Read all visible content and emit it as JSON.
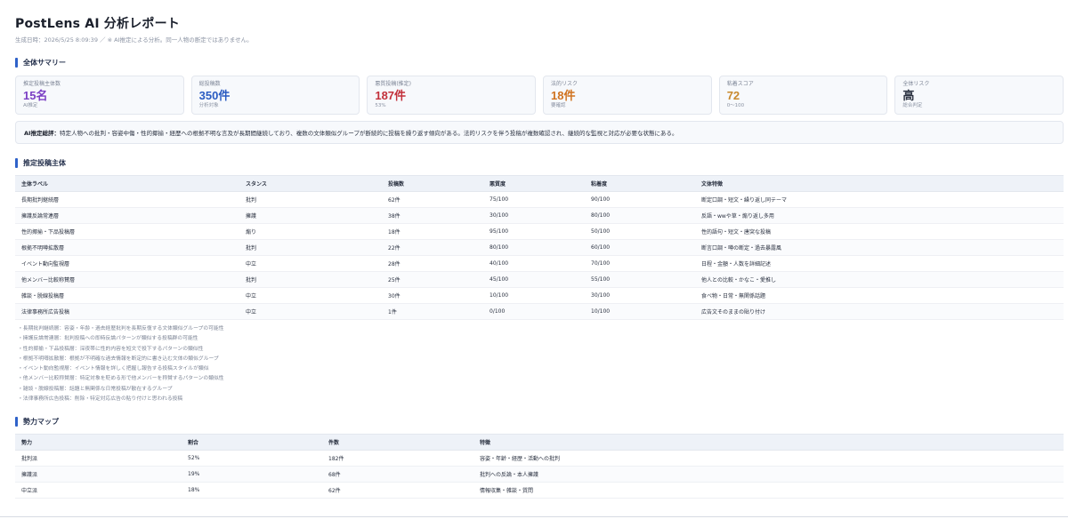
{
  "header": {
    "title": "PostLens AI 分析レポート",
    "meta": "生成日時：2026/5/25 8:09:39 ／ ※ AI推定による分析。同一人物の断定ではありません。"
  },
  "summary_section": {
    "title": "全体サマリー",
    "cards": [
      {
        "label": "推定投稿主体数",
        "value": "15名",
        "sub": "AI推定",
        "color": "#7b3fc4"
      },
      {
        "label": "総投稿数",
        "value": "350件",
        "sub": "分析対象",
        "color": "#2a5bc2"
      },
      {
        "label": "悪質投稿(推定)",
        "value": "187件",
        "sub": "53%",
        "color": "#c2303a"
      },
      {
        "label": "法的リスク",
        "value": "18件",
        "sub": "要確認",
        "color": "#d0731f"
      },
      {
        "label": "粘着スコア",
        "value": "72",
        "sub": "0〜100",
        "color": "#c8892c"
      },
      {
        "label": "全体リスク",
        "value": "高",
        "sub": "総合判定",
        "color": "#2a3140"
      }
    ],
    "ai_summary_label": "AI推定総評：",
    "ai_summary_text": "特定人物への批判・容姿中傷・性的揶揄・経歴への根拠不明な言及が長期間継続しており、複数の文体類似グループが断続的に投稿を繰り返す傾向がある。法的リスクを伴う投稿が複数確認され、継続的な監視と対応が必要な状態にある。"
  },
  "actors_section": {
    "title": "推定投稿主体",
    "columns": [
      "主体ラベル",
      "スタンス",
      "投稿数",
      "悪質度",
      "粘着度",
      "文体特徴"
    ],
    "rows": [
      [
        "長期批判継続層",
        "批判",
        "62件",
        "75/100",
        "90/100",
        "断定口調・短文・繰り返し同テーマ"
      ],
      [
        "擁護反論常連層",
        "擁護",
        "38件",
        "30/100",
        "80/100",
        "反語・wwや草・煽り返し多用"
      ],
      [
        "性的揶揄・下品投稿層",
        "煽り",
        "18件",
        "95/100",
        "50/100",
        "性的語句・短文・唐突な投稿"
      ],
      [
        "根拠不明噂拡散層",
        "批判",
        "22件",
        "80/100",
        "60/100",
        "断言口調・噂の断定・過去暴露風"
      ],
      [
        "イベント動向監視層",
        "中立",
        "28件",
        "40/100",
        "70/100",
        "日程・金額・人数を詳細記述"
      ],
      [
        "他メンバー比較称賛層",
        "批判",
        "25件",
        "45/100",
        "55/100",
        "他人との比較・かなこ・愛推し"
      ],
      [
        "雑談・脱線投稿層",
        "中立",
        "30件",
        "10/100",
        "30/100",
        "食べ物・日常・無関係話題"
      ],
      [
        "法律事務所広告投稿",
        "中立",
        "1件",
        "0/100",
        "10/100",
        "広告文そのままの貼り付け"
      ]
    ],
    "notes": [
      "・長期批判継続層：容姿・年齢・過去経歴批判を長期反復する文体類似グループの可能性",
      "・擁護反論常連層：批判投稿への即時反論パターンが類似する投稿群の可能性",
      "・性的揶揄・下品投稿層：深夜帯に性的内容を短文で投下するパターンの類似性",
      "・根拠不明噂拡散層：根拠が不明確な過去情報を断定的に書き込む文体の類似グループ",
      "・イベント動向監視層：イベント情報を詳しく把握し報告する投稿スタイルが類似",
      "・他メンバー比較称賛層：特定対象を貶める形で他メンバーを称賛するパターンの類似性",
      "・雑談・脱線投稿層：話題と無関係な日常投稿が散在するグループ",
      "・法律事務所広告投稿：削除・特定対応広告の貼り付けと思われる投稿"
    ]
  },
  "power_section": {
    "title": "勢力マップ",
    "columns": [
      "勢力",
      "割合",
      "件数",
      "特徴"
    ],
    "rows": [
      [
        "批判派",
        "52%",
        "182件",
        "容姿・年齢・経歴・活動への批判"
      ],
      [
        "擁護派",
        "19%",
        "68件",
        "批判への反論・本人擁護"
      ],
      [
        "中立派",
        "18%",
        "62件",
        "情報収集・雑談・質問"
      ]
    ]
  }
}
